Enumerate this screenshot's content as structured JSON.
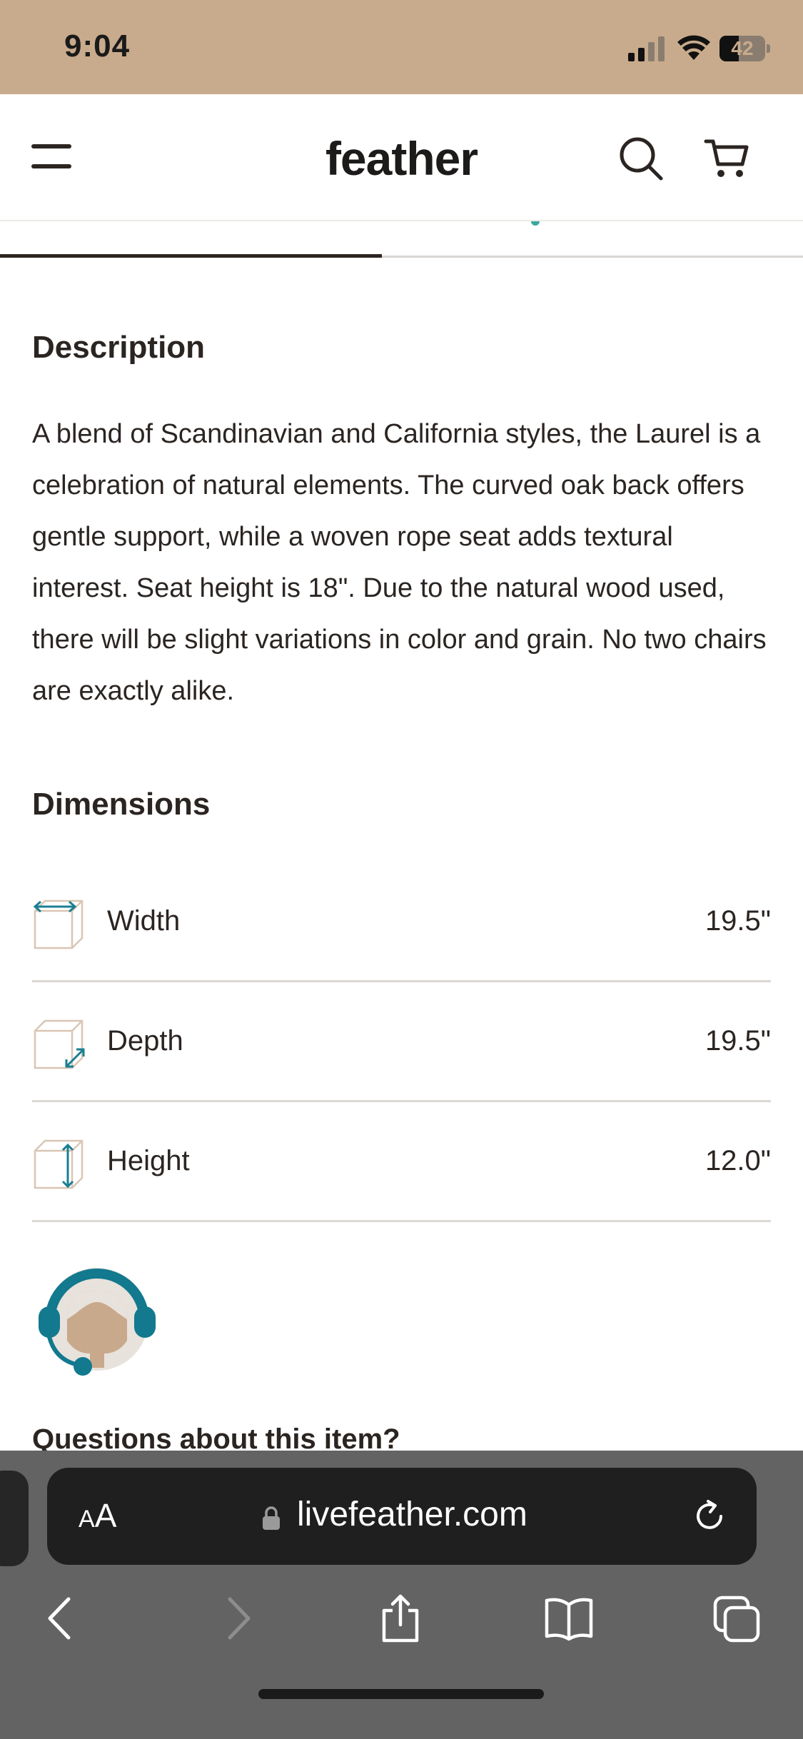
{
  "status_bar": {
    "time": "9:04",
    "battery_level": "42",
    "battery_fraction": 0.42,
    "background_color": "#c8ab8c"
  },
  "header": {
    "logo": "feather",
    "menu_icon": "hamburger-menu-icon",
    "search_icon": "search-icon",
    "cart_icon": "cart-icon"
  },
  "tabs": {
    "accent_color": "#3aa7a0"
  },
  "description": {
    "title": "Description",
    "body": "A blend of Scandinavian and California styles, the Laurel is a celebration of natural elements. The curved oak back offers gentle support, while a woven rope seat adds textural interest. Seat height is 18\". Due to the natural wood used, there will be slight variations in color and grain. No two chairs are exactly alike."
  },
  "dimensions": {
    "title": "Dimensions",
    "rows": [
      {
        "label": "Width",
        "value": "19.5\"",
        "icon": "width-box-icon"
      },
      {
        "label": "Depth",
        "value": "19.5\"",
        "icon": "depth-box-icon"
      },
      {
        "label": "Height",
        "value": "12.0\"",
        "icon": "height-box-icon"
      }
    ],
    "icon_accent_color": "#1a7f93"
  },
  "support": {
    "avatar_icon": "support-agent-icon",
    "question": "Questions about this item?"
  },
  "browser": {
    "aa_label_big": "A",
    "aa_label_small": "A",
    "url": "livefeather.com",
    "nav": [
      "back-icon",
      "forward-icon",
      "share-icon",
      "bookmarks-icon",
      "tabs-icon"
    ]
  }
}
